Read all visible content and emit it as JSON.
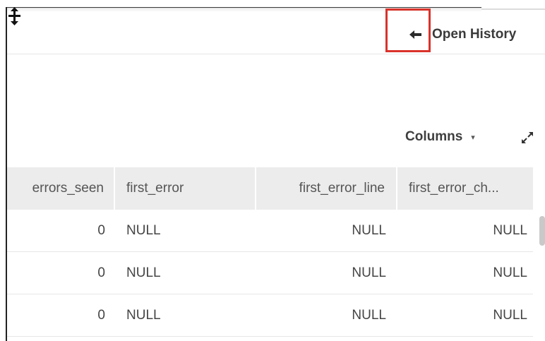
{
  "header": {
    "history_link": "Open History",
    "back_icon": "arrow-left-icon",
    "resize_icon": "resize-cursor-icon"
  },
  "toolbar": {
    "columns_label": "Columns",
    "columns_caret": "▾",
    "expand_icon": "expand-icon"
  },
  "table": {
    "columns": [
      "errors_seen",
      "first_error",
      "first_error_line",
      "first_error_ch..."
    ],
    "rows": [
      [
        "0",
        "NULL",
        "NULL",
        "NULL"
      ],
      [
        "0",
        "NULL",
        "NULL",
        "NULL"
      ],
      [
        "0",
        "NULL",
        "NULL",
        "NULL"
      ]
    ]
  },
  "colors": {
    "highlight_border": "#d9332b",
    "header_bg": "#ececec"
  }
}
